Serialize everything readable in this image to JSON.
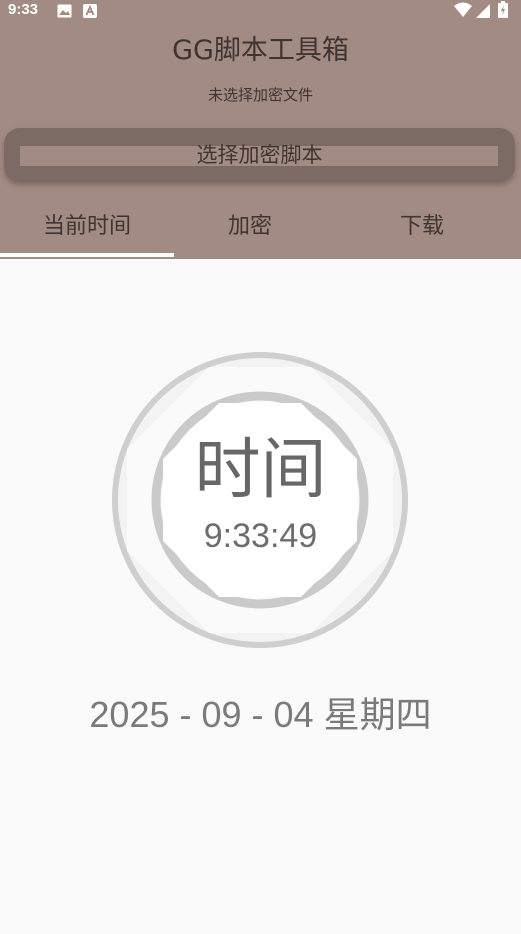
{
  "status_bar": {
    "time": "9:33",
    "icons": [
      "image-icon",
      "a-icon",
      "wifi-icon",
      "signal-icon",
      "battery-icon"
    ]
  },
  "header": {
    "title": "GG脚本工具箱",
    "subtitle": "未选择加密文件",
    "select_button": "选择加密脚本"
  },
  "tabs": [
    {
      "label": "当前时间",
      "selected": true
    },
    {
      "label": "加密",
      "selected": false
    },
    {
      "label": "下载",
      "selected": false
    }
  ],
  "clock": {
    "label": "时间",
    "time": "9:33:49"
  },
  "date": {
    "text": "2025 - 09 - 04  星期四"
  },
  "colors": {
    "header_bg": "#a28b82",
    "button_bg": "#7c6a64",
    "content_bg": "#fafafa",
    "tab_indicator": "#ffffff"
  }
}
